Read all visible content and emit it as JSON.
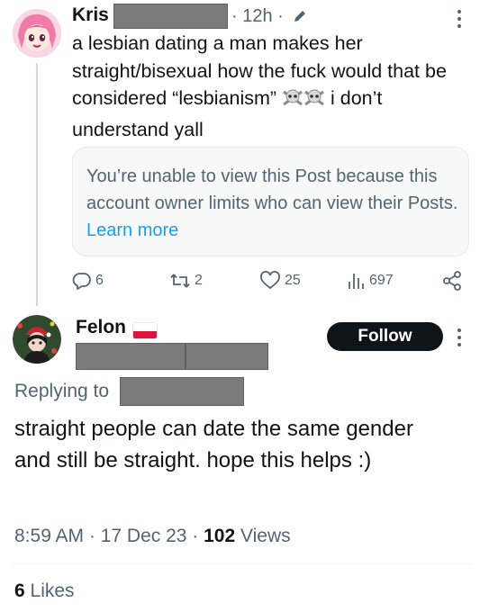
{
  "tweet": {
    "author_name": "Kris",
    "time_label": "12h",
    "text": "a lesbian dating a man makes her straight/bisexual how the fuck would that be considered “lesbianism”",
    "text_tail": "i don’t understand yall",
    "emoji": [
      "skull-crossbones",
      "skull-crossbones"
    ],
    "notice": {
      "text": "You’re unable to view this Post because this account owner limits who can view their Posts.",
      "link": "Learn more"
    },
    "actions": {
      "replies": "6",
      "reposts": "2",
      "likes": "25",
      "views": "697"
    }
  },
  "reply": {
    "author_name": "Felon",
    "flag": "poland-flag",
    "follow_label": "Follow",
    "replying_to_label": "Replying to",
    "text": "straight people can date the same gender and still be straight. hope this helps :)",
    "timestamp": "8:59 AM · 17 Dec 23 ·",
    "views_count": "102",
    "views_label": "Views",
    "likes_count": "6",
    "likes_label": "Likes"
  },
  "colors": {
    "link": "#1d9bf0",
    "secondary": "#536471",
    "redaction": "#7b7b7b",
    "follow_bg": "#0f1419"
  }
}
